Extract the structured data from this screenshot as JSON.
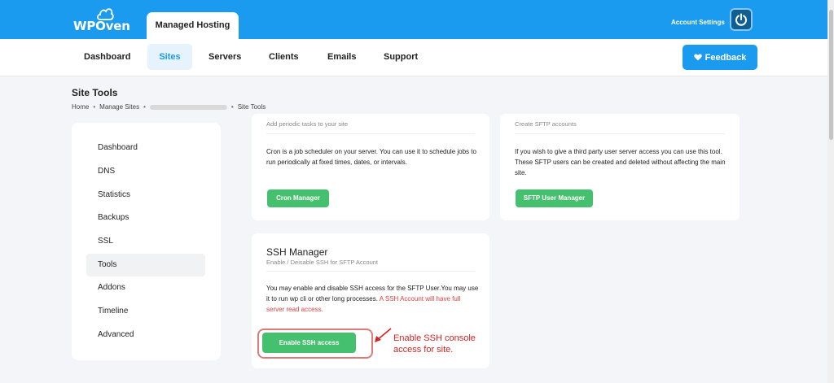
{
  "header": {
    "logo_text": "WPOven",
    "active_tab": "Managed Hosting",
    "account_label": "Account Settings"
  },
  "nav": {
    "items": [
      "Dashboard",
      "Sites",
      "Servers",
      "Clients",
      "Emails",
      "Support"
    ],
    "active": "Sites",
    "feedback_label": "Feedback"
  },
  "page": {
    "title": "Site Tools",
    "breadcrumb": [
      "Home",
      "Manage Sites",
      "Site Tools"
    ]
  },
  "sidebar": {
    "items": [
      "Dashboard",
      "DNS",
      "Statistics",
      "Backups",
      "SSL",
      "Tools",
      "Addons",
      "Timeline",
      "Advanced"
    ],
    "active": "Tools"
  },
  "cron_card": {
    "subtitle": "Add periodic tasks to your site",
    "text": "Cron is a job scheduler on your server. You can use it to schedule jobs to run periodically at fixed times, dates, or intervals.",
    "button": "Cron Manager"
  },
  "sftp_card": {
    "subtitle": "Create SFTP accounts",
    "text": "If you wish to give a third party user server access you can use this tool. These SFTP users can be created and deleted without affecting the main site.",
    "button": "SFTP User Manager"
  },
  "ssh_card": {
    "title": "SSH Manager",
    "subtitle": "Enable / Deisable SSH for SFTP Account",
    "text": "You may enable and disable SSH access for the SFTP User.You may use it to run wp cli or other long processes.",
    "warning": "A SSH Account will have full server read access.",
    "button": "Enable SSH access"
  },
  "annotation": {
    "line1": "Enable SSH console",
    "line2": "access for site."
  },
  "colors": {
    "brand_blue": "#1a9bef",
    "button_green": "#45c06e",
    "warning_red": "#e2413f",
    "annotation_red": "#d42222"
  }
}
